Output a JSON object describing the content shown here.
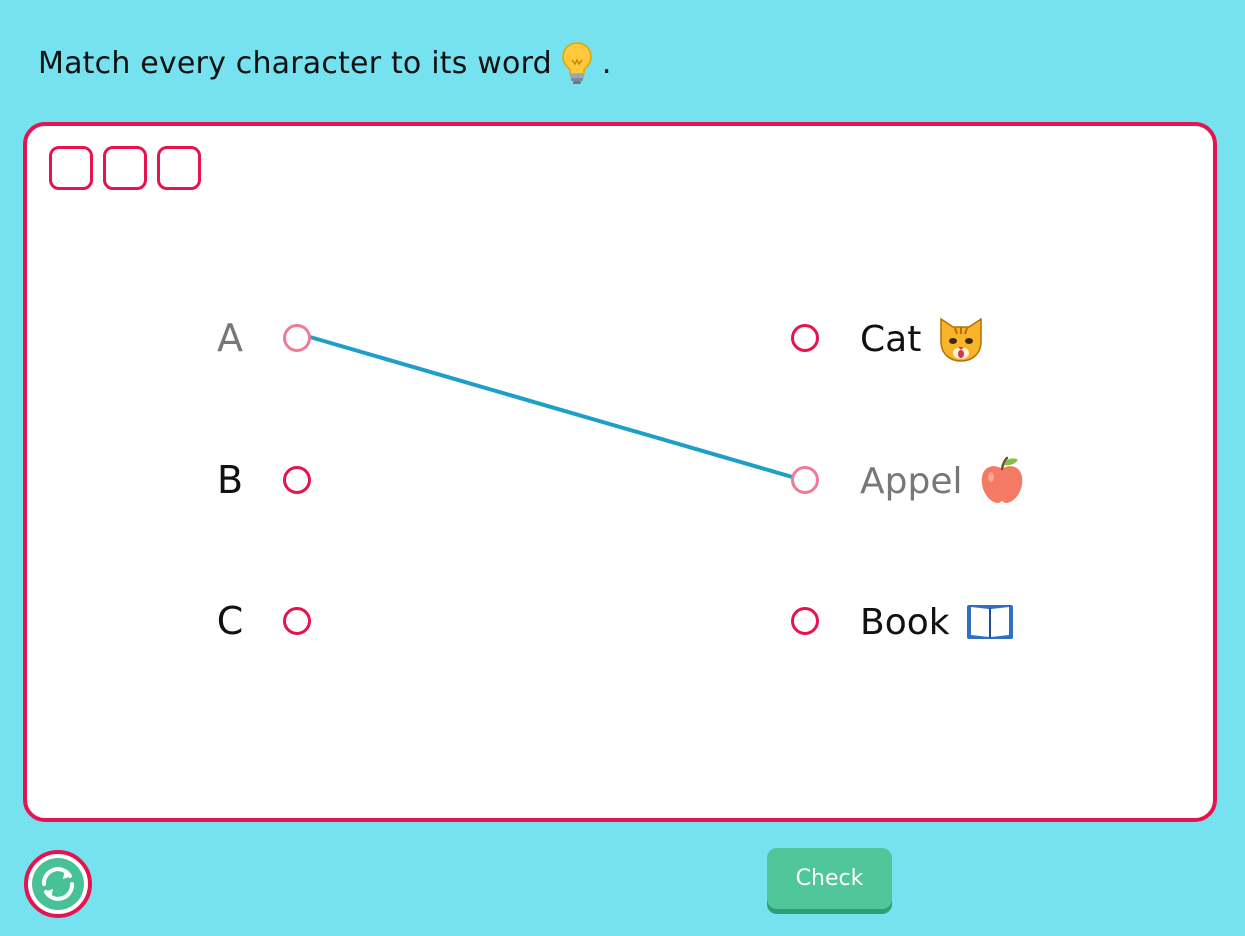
{
  "instruction": {
    "text": "Match every character to its word",
    "suffix": ".",
    "icon": "lightbulb-icon"
  },
  "slots": [
    {
      "id": "slot-1"
    },
    {
      "id": "slot-2"
    },
    {
      "id": "slot-3"
    }
  ],
  "left_items": [
    {
      "label": "A",
      "state": "connected"
    },
    {
      "label": "B",
      "state": "open"
    },
    {
      "label": "C",
      "state": "open"
    }
  ],
  "right_items": [
    {
      "label": "Cat",
      "icon": "cat-face-icon",
      "state": "open"
    },
    {
      "label": "Appel",
      "icon": "apple-icon",
      "state": "connected"
    },
    {
      "label": "Book",
      "icon": "book-icon",
      "state": "open"
    }
  ],
  "connections": [
    {
      "from": "A",
      "to": "Appel"
    }
  ],
  "buttons": {
    "check_label": "Check",
    "reset_icon": "refresh-icon"
  },
  "colors": {
    "background": "#76e1ef",
    "accent": "#e5134f",
    "connector_line": "#1e9fc7",
    "check_button": "#4fc79a"
  }
}
